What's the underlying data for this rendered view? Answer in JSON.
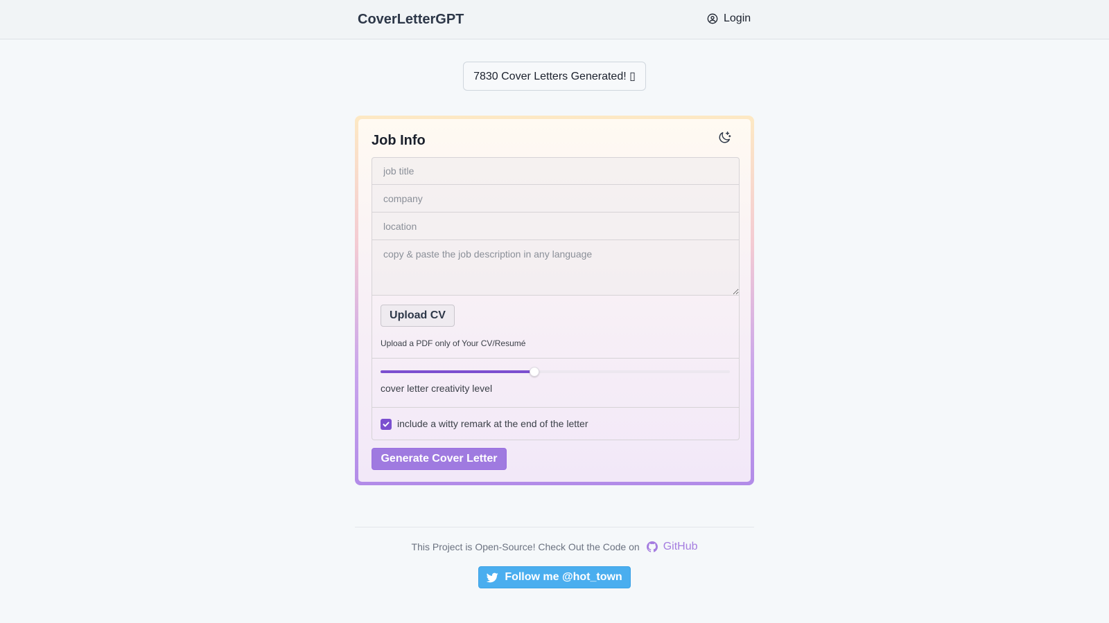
{
  "header": {
    "brand": "CoverLetterGPT",
    "login_label": "Login"
  },
  "counter": {
    "text": "7830 Cover Letters Generated! ▯"
  },
  "job_info": {
    "title": "Job Info",
    "fields": {
      "job_title_placeholder": "job title",
      "company_placeholder": "company",
      "location_placeholder": "location",
      "description_placeholder": "copy & paste the job description in any language"
    },
    "upload": {
      "button_label": "Upload CV",
      "hint": "Upload a PDF only of Your CV/Resumé"
    },
    "creativity": {
      "label": "cover letter creativity level",
      "value_fraction": 0.44
    },
    "witty": {
      "label": "include a witty remark at the end of the letter",
      "checked": true
    },
    "generate_label": "Generate Cover Letter"
  },
  "footer": {
    "open_source_text": "This Project is Open-Source! Check Out the Code on",
    "github_label": "GitHub",
    "twitter_label": "Follow me @hot_town"
  },
  "colors": {
    "accent": "#7b4fcf",
    "generate_button": "#9f7ae0",
    "twitter": "#4aaeef",
    "github_link": "#a57de0"
  },
  "icons": {
    "login": "user-circle-icon",
    "theme_toggle": "moon-sparkle-icon",
    "github": "github-icon",
    "twitter": "twitter-icon",
    "checkbox": "check-icon"
  }
}
